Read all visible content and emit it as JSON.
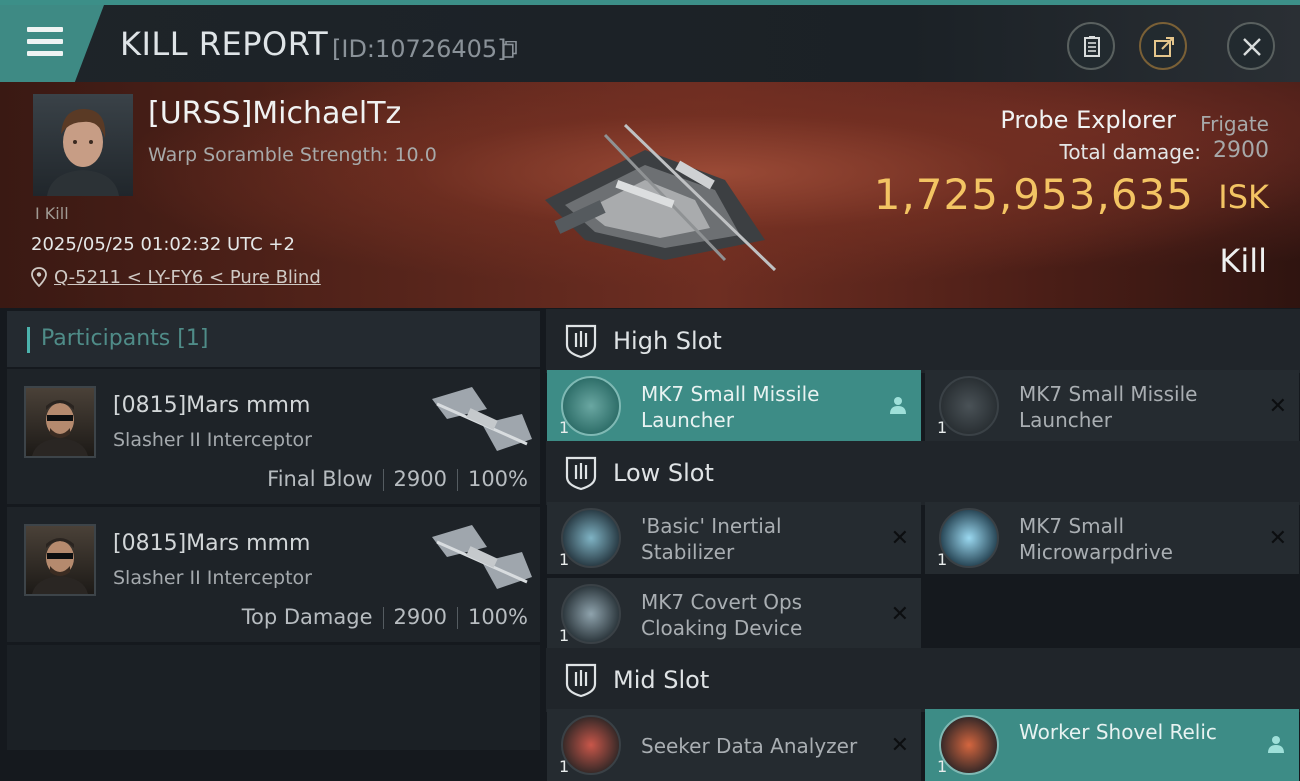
{
  "header": {
    "title": "KILL REPORT",
    "report_id": "[ID:10726405]"
  },
  "victim": {
    "name": "[URSS]MichaelTz",
    "warp_scramble": "Warp Soramble Strength: 10.0",
    "kill_count": "I Kill",
    "datetime": "2025/05/25 01:02:32 UTC +2",
    "location": "Q-5211 < LY-FY6 < Pure Blind",
    "ship_name": "Probe Explorer",
    "ship_class": "Frigate",
    "total_damage_label": "Total damage:",
    "total_damage": "2900",
    "isk_value": "1,725,953,635",
    "isk_unit": "ISK",
    "result": "Kill"
  },
  "participants": {
    "title": "Participants",
    "count": "[1]",
    "rows": [
      {
        "name": "[0815]Mars mmm",
        "ship": "Slasher II Interceptor",
        "role": "Final Blow",
        "damage": "2900",
        "percent": "100%"
      },
      {
        "name": "[0815]Mars mmm",
        "ship": "Slasher II Interceptor",
        "role": "Top Damage",
        "damage": "2900",
        "percent": "100%"
      }
    ]
  },
  "slots": {
    "high": {
      "label": "High Slot",
      "items": [
        {
          "name": "MK7 Small Missile Launcher",
          "qty": "1",
          "icon": "missile-launcher-icon"
        },
        {
          "name": "MK7 Small Missile Launcher",
          "qty": "1",
          "icon": "missile-launcher-icon"
        }
      ]
    },
    "low": {
      "label": "Low Slot",
      "items": [
        {
          "name": "'Basic' Inertial Stabilizer",
          "qty": "1",
          "icon": "inertial-stabilizer-icon"
        },
        {
          "name": "MK7 Small Microwarpdrive",
          "qty": "1",
          "icon": "microwarpdrive-icon"
        },
        {
          "name": "MK7 Covert Ops Cloaking Device",
          "qty": "1",
          "icon": "cloaking-device-icon"
        }
      ]
    },
    "mid": {
      "label": "Mid Slot",
      "items": [
        {
          "name": "Seeker Data Analyzer",
          "qty": "1",
          "icon": "data-analyzer-icon"
        },
        {
          "name": "Worker Shovel Relic",
          "qty": "1",
          "icon": "relic-analyzer-icon"
        }
      ]
    }
  },
  "colors": {
    "accent": "#3e8a84",
    "isk": "#f3c463"
  }
}
